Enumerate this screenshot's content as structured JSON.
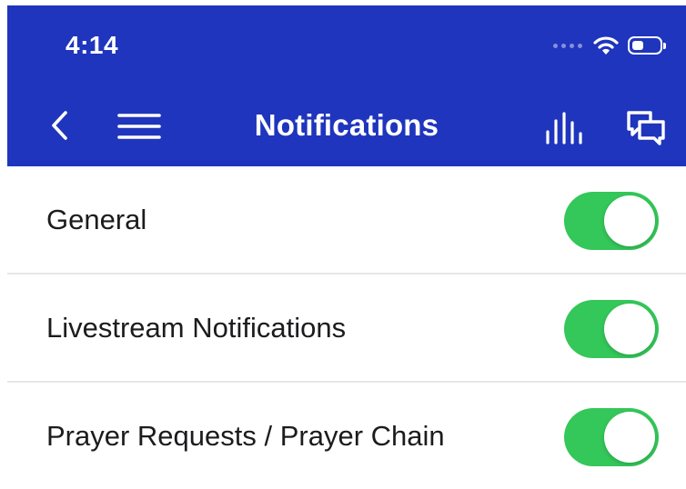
{
  "colors": {
    "app_bar": "#1f35bd",
    "toggle_on": "#34c759",
    "divider": "#e7e7e9"
  },
  "status_bar": {
    "time": "4:14",
    "icons": [
      "signal-dots-icon",
      "wifi-icon",
      "battery-icon"
    ],
    "battery_level": 0.4
  },
  "nav": {
    "title": "Notifications",
    "left_icons": [
      "back-chevron-icon",
      "hamburger-menu-icon"
    ],
    "right_icons": [
      "audio-bars-icon",
      "chat-bubbles-icon"
    ]
  },
  "settings": [
    {
      "label": "General",
      "enabled": true
    },
    {
      "label": "Livestream Notifications",
      "enabled": true
    },
    {
      "label": "Prayer Requests / Prayer Chain",
      "enabled": true
    }
  ]
}
